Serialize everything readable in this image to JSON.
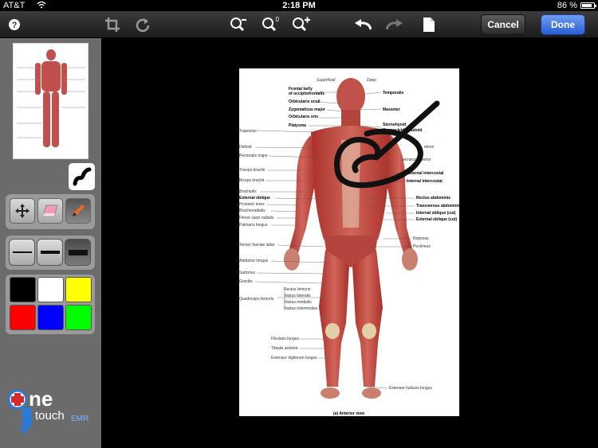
{
  "status_bar": {
    "carrier": "AT&T",
    "time": "2:18 PM",
    "battery": "86 %",
    "battery_level": 0.86
  },
  "toolbar": {
    "icons": [
      "help-icon",
      "crop-icon",
      "rotate-icon",
      "zoom-out-icon",
      "zoom-reset-icon",
      "zoom-in-icon",
      "undo-icon",
      "redo-icon",
      "page-icon"
    ],
    "zoom_reset_badge": "0",
    "cancel_label": "Cancel",
    "done_label": "Done"
  },
  "sidebar": {
    "tools": [
      "move-tool",
      "eraser-tool",
      "pen-tool"
    ],
    "active_tool": "pen-tool",
    "stroke_widths": [
      "thin",
      "medium",
      "thick"
    ],
    "active_width": "thick",
    "colors": [
      "#000000",
      "#ffffff",
      "#ffff00",
      "#ff0000",
      "#0000ff",
      "#00ff00"
    ],
    "logo": {
      "line1": "ne",
      "line2": "touch",
      "line3": "EMR"
    }
  },
  "diagram": {
    "header_left": "Superficial",
    "header_right": "Deep",
    "caption": "(a) Anterior view",
    "labels_left": [
      "Trapezius",
      "Deltoid",
      "Pectoralis major",
      "Triceps brachii",
      "Biceps brachii",
      "Brachialis",
      "External oblique",
      "Pronator teres",
      "Brachioradialis",
      "Flexor carpi radialis",
      "Palmaris longus",
      "Tensor fasciae latae",
      "Adductor longus",
      "Sartorius",
      "Gracilis",
      "Quadriceps femoris",
      "Fibularis longus",
      "Tibialis anterior",
      "Extensor digitorum longus"
    ],
    "labels_top": [
      "Frontal belly",
      "of occipitofrontalis",
      "Orbicularis oculi",
      "Zygomaticus major",
      "Orbicularis oris",
      "Platysma"
    ],
    "labels_right": [
      "Temporalis",
      "Masseter",
      "Sternohyoid",
      "Sternocleidomastoid",
      "minor",
      "serratus anterior",
      "External intercostal",
      "Internal intercostal",
      "Rectus abdominis",
      "Transversus abdominis",
      "Internal oblique (cut)",
      "External oblique (cut)",
      "Iliopsoas",
      "Pectineus",
      "Extensor hallucis longus"
    ],
    "labels_quad": [
      "Rectus femoris",
      "Vastus lateralis",
      "Vastus medialis",
      "Vastus intermedius"
    ]
  }
}
